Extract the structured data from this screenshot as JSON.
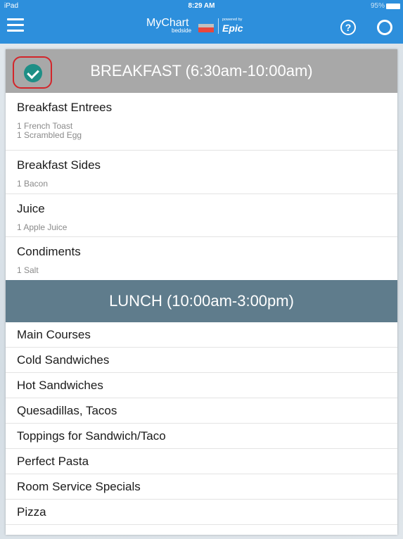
{
  "status_bar": {
    "device": "iPad",
    "time": "8:29 AM",
    "battery": "95%"
  },
  "nav": {
    "logo_main": "MyChart",
    "logo_sub": "bedside",
    "powered_by": "powered by",
    "brand": "Epic",
    "help_label": "?"
  },
  "breakfast": {
    "header": "BREAKFAST (6:30am-10:00am)",
    "items": [
      {
        "title": "Breakfast Entrees",
        "details": [
          "1 French Toast",
          "1 Scrambled Egg"
        ]
      },
      {
        "title": "Breakfast Sides",
        "details": [
          "1 Bacon"
        ]
      },
      {
        "title": "Juice",
        "details": [
          "1 Apple Juice"
        ]
      },
      {
        "title": "Condiments",
        "details": [
          "1 Salt"
        ]
      }
    ]
  },
  "lunch": {
    "header": "LUNCH (10:00am-3:00pm)",
    "items": [
      "Main Courses",
      "Cold Sandwiches",
      "Hot Sandwiches",
      "Quesadillas, Tacos",
      "Toppings for Sandwich/Taco",
      "Perfect Pasta",
      "Room Service Specials",
      "Pizza"
    ]
  },
  "colors": {
    "nav_blue": "#2d8fdc",
    "breakfast_header": "#a8a8a8",
    "lunch_header": "#5f7c8c",
    "check_teal": "#1e8f86",
    "highlight_red": "#d3252a"
  }
}
